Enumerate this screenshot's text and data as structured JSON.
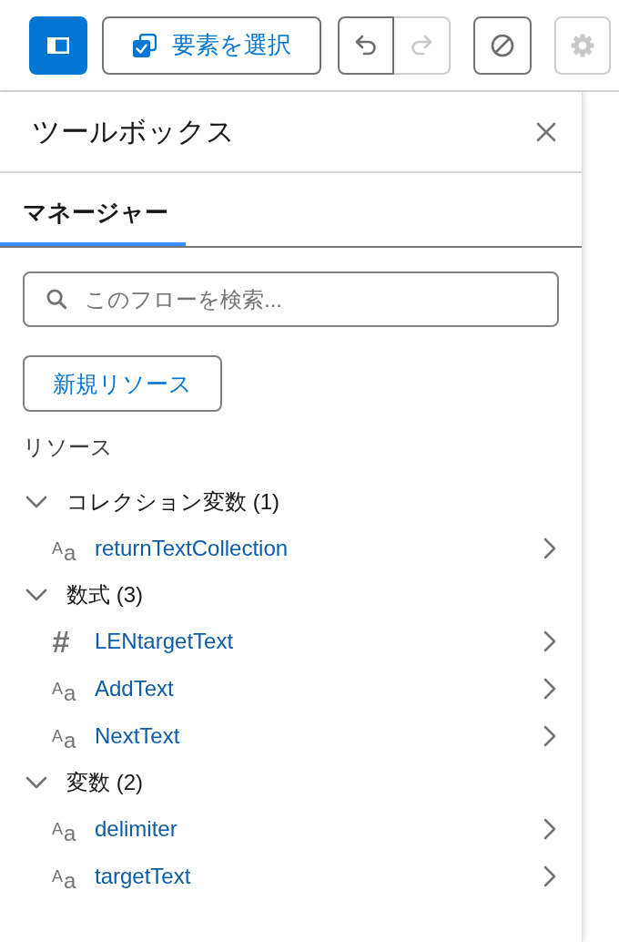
{
  "toolbar": {
    "panel_toggle": {
      "selected": true
    },
    "select_button": {
      "label": "要素を選択"
    },
    "history": [
      {
        "kind": "undo",
        "disabled": false
      },
      {
        "kind": "redo",
        "disabled": true
      }
    ],
    "tools": [
      {
        "kind": "stop",
        "disabled": false
      },
      {
        "kind": "settings",
        "disabled": true
      }
    ]
  },
  "panel": {
    "title": "ツールボックス",
    "tabs": [
      {
        "label": "マネージャー",
        "selected": true
      }
    ],
    "search": {
      "placeholder": "このフローを検索..."
    },
    "new_button": {
      "label": "新規リソース"
    },
    "section_label": "リソース",
    "tree": [
      {
        "label": "コレクション変数 (1)",
        "expanded": true,
        "children": [
          {
            "kind": "text",
            "glyph": "A$_{a}$",
            "label": "returnTextCollection"
          }
        ]
      },
      {
        "label": "数式 (3)",
        "expanded": true,
        "children": [
          {
            "kind": "number",
            "glyph": "#",
            "label": "LENtargetText"
          },
          {
            "kind": "text",
            "glyph": "A$_{a}$",
            "label": "AddText"
          },
          {
            "kind": "text",
            "glyph": "A$_{a}$",
            "label": "NextText"
          }
        ]
      },
      {
        "label": "変数 (2)",
        "expanded": true,
        "children": [
          {
            "kind": "text",
            "glyph": "A$_{a}$",
            "label": "delimiter"
          },
          {
            "kind": "text",
            "glyph": "A$_{a}$",
            "label": "targetText"
          }
        ]
      }
    ]
  }
}
